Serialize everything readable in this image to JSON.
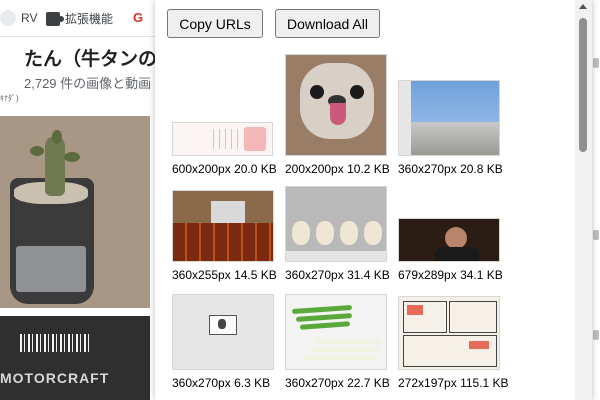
{
  "browser": {
    "bookmarks": [
      {
        "label": "RV",
        "icon": "bookmark-favicon"
      },
      {
        "label": "拡張機能",
        "icon": "puzzle-icon"
      },
      {
        "label": "G",
        "icon": "gmail-icon"
      }
    ],
    "page_title": "たん（牛タンの",
    "page_subtitle": "2,729 件の画像と動画",
    "page_small_text": "ｷﾅﾀﾞ)",
    "bottom_tile_text": "MOTORCRAFT"
  },
  "popup": {
    "copy_label": "Copy URLs",
    "download_label": "Download All",
    "images": [
      {
        "dims": "600x200px",
        "size": "20.0 KB",
        "kind": "text-page"
      },
      {
        "dims": "200x200px",
        "size": "10.2 KB",
        "kind": "pug-dog"
      },
      {
        "dims": "360x270px",
        "size": "20.8 KB",
        "kind": "city-view"
      },
      {
        "dims": "360x255px",
        "size": "14.5 KB",
        "kind": "stage-room"
      },
      {
        "dims": "360x270px",
        "size": "31.4 KB",
        "kind": "masks"
      },
      {
        "dims": "679x289px",
        "size": "34.1 KB",
        "kind": "movie-still"
      },
      {
        "dims": "360x270px",
        "size": "6.3 KB",
        "kind": "sketch"
      },
      {
        "dims": "360x270px",
        "size": "22.7 KB",
        "kind": "green-onions"
      },
      {
        "dims": "272x197px",
        "size": "115.1 KB",
        "kind": "manga-panel"
      }
    ]
  }
}
